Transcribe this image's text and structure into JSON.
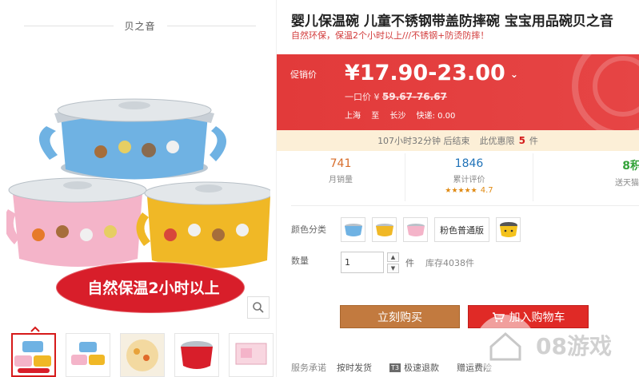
{
  "shop": {
    "name": "贝之音"
  },
  "product": {
    "title": "婴儿保温碗 儿童不锈钢带盖防摔碗 宝宝用品碗贝之音",
    "subtitle": "自然环保，保温2个小时以上///不锈钢+防烫防摔！",
    "image_banner": "自然保温2小时以上"
  },
  "price": {
    "promo_label": "促销价",
    "value": "¥17.90-23.00",
    "original_label": "一口价 ¥",
    "original_value": "59.67-76.67",
    "ship_from": "上海",
    "ship_to_label": "至",
    "ship_to": "长沙",
    "express": "快递: 0.00"
  },
  "countdown": {
    "time_text": "107小时32分钟 后结束",
    "limit_prefix": "此优惠限",
    "limit_value": "5",
    "limit_suffix": "件"
  },
  "stats": {
    "sales": {
      "value": "741",
      "label": "月销量"
    },
    "reviews": {
      "value": "1846",
      "label": "累计评价",
      "stars": "★★★★★",
      "score": "4.7"
    },
    "points": {
      "value": "8积",
      "label": "送天猫"
    }
  },
  "options": {
    "color_label": "颜色分类",
    "swatches": [
      "blue-bowl",
      "yellow-bowl",
      "pink-bowl"
    ],
    "text_option": "粉色普通版",
    "qty_label": "数量",
    "qty_value": "1",
    "qty_unit": "件",
    "stock": "库存4038件"
  },
  "buttons": {
    "buy_now": "立刻购买",
    "add_cart": "加入购物车"
  },
  "promises": {
    "label": "服务承诺",
    "items": [
      "按时发货",
      "极速退款",
      "赠运费险"
    ],
    "badge": "T3"
  },
  "watermark": {
    "text": "08游戏"
  },
  "colors": {
    "price_bg": "#e4393c",
    "buy_now_bg": "#c27a3f",
    "add_cart_bg": "#e02a26",
    "countdown_bg": "#fcefd7"
  }
}
